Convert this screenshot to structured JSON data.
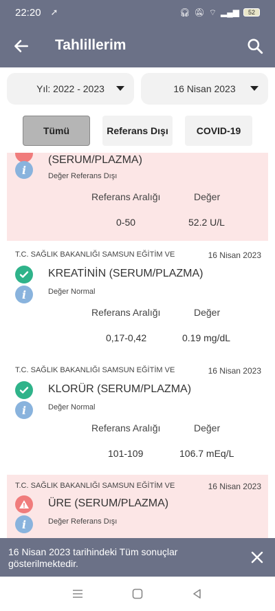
{
  "status_bar": {
    "time": "22:20",
    "battery": "52"
  },
  "app_bar": {
    "title": "Tahlillerim"
  },
  "filters": {
    "year": "Yıl: 2022 - 2023",
    "date": "16 Nisan 2023"
  },
  "tabs": [
    {
      "label": "Tümü",
      "active": true
    },
    {
      "label": "Referans Dışı",
      "active": false
    },
    {
      "label": "COVID-19",
      "active": false
    }
  ],
  "headers": {
    "range": "Referans Aralığı",
    "value": "Değer"
  },
  "results": [
    {
      "institution": "",
      "date": "",
      "name": "(SERUM/PLAZMA)",
      "status": "Değer Referans Dışı",
      "range": "0-50",
      "value": "52.2 U/L",
      "flag": "alert"
    },
    {
      "institution": "T.C. SAĞLIK BAKANLIĞI SAMSUN EĞİTİM VE",
      "date": "16 Nisan 2023",
      "name": "KREATİNİN (SERUM/PLAZMA)",
      "status": "Değer Normal",
      "range": "0,17-0,42",
      "value": "0.19 mg/dL",
      "flag": "ok"
    },
    {
      "institution": "T.C. SAĞLIK BAKANLIĞI SAMSUN EĞİTİM VE",
      "date": "16 Nisan 2023",
      "name": "KLORÜR (SERUM/PLAZMA)",
      "status": "Değer Normal",
      "range": "101-109",
      "value": "106.7 mEq/L",
      "flag": "ok"
    },
    {
      "institution": "T.C. SAĞLIK BAKANLIĞI SAMSUN EĞİTİM VE",
      "date": "16 Nisan 2023",
      "name": "ÜRE (SERUM/PLAZMA)",
      "status": "Değer Referans Dışı",
      "range": "",
      "value": "",
      "flag": "alert"
    }
  ],
  "snackbar": {
    "line1": "16 Nisan 2023 tarihindeki Tüm sonuçlar",
    "line2": "gösterilmektedir."
  }
}
